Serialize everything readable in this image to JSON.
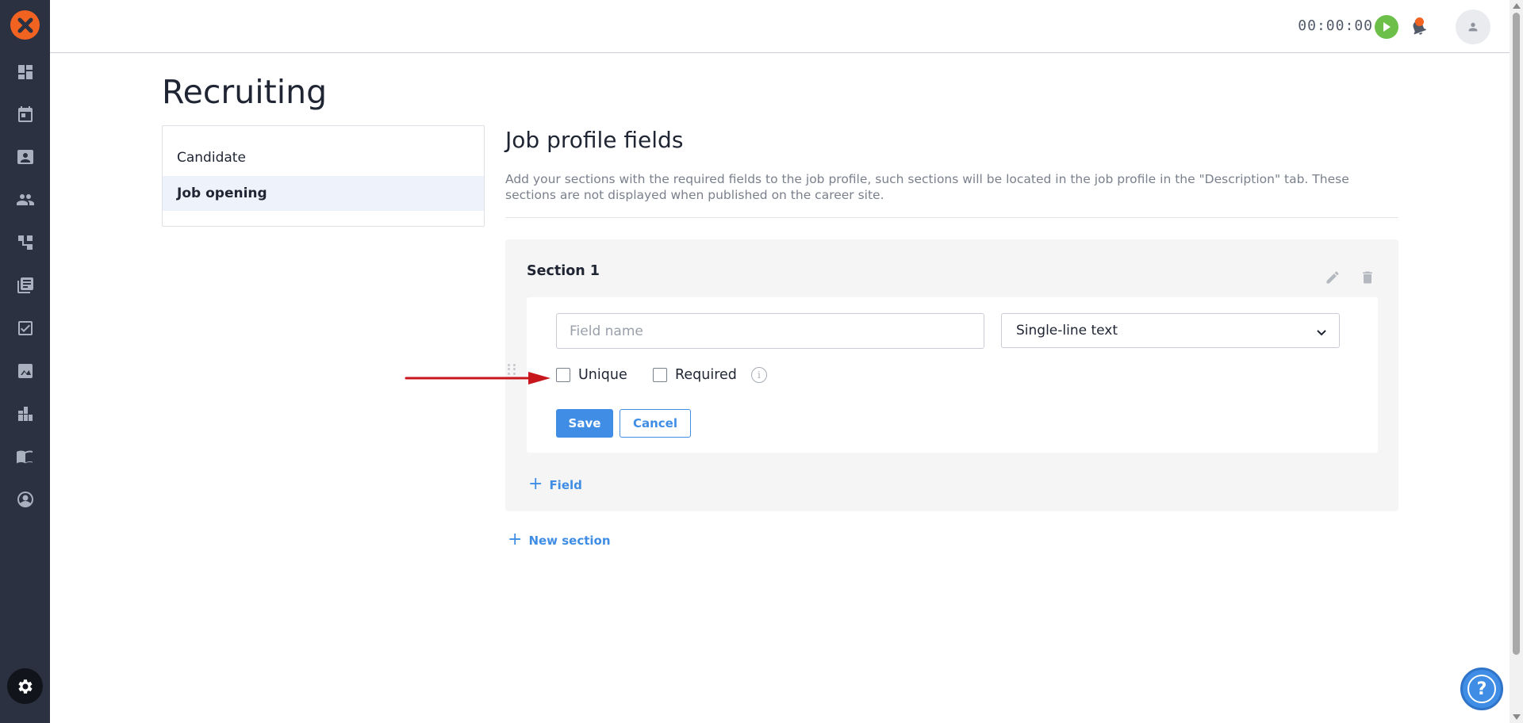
{
  "app": {
    "brand_color": "#f26322",
    "accent_color": "#3f8de4",
    "sidebar_icons": [
      "dashboard-icon",
      "calendar-icon",
      "contact-card-icon",
      "people-icon",
      "workflow-icon",
      "library-icon",
      "checkbox-icon",
      "chart-icon",
      "modules-icon",
      "book-icon",
      "user-circle-icon"
    ],
    "settings_icon": "gear-icon"
  },
  "topbar": {
    "timer": "00:00:00",
    "play_icon": "play-icon",
    "notifications_icon": "bell-icon",
    "avatar_icon": "user-icon"
  },
  "page": {
    "title": "Recruiting"
  },
  "settings_menu": {
    "items": [
      {
        "label": "Candidate",
        "active": false
      },
      {
        "label": "Job opening",
        "active": true
      }
    ]
  },
  "main": {
    "heading": "Job profile fields",
    "description": "Add your sections with the required fields to the job profile, such sections will be located in the job profile in the \"Description\" tab. These sections are not displayed when published on the career site.",
    "section": {
      "title": "Section 1",
      "edit_icon": "pencil-icon",
      "delete_icon": "trash-icon",
      "field": {
        "name_value": "",
        "name_placeholder": "Field name",
        "type_selected": "Single-line text",
        "unique_label": "Unique",
        "unique_checked": false,
        "required_label": "Required",
        "required_checked": false,
        "info_icon": "info-icon",
        "save_label": "Save",
        "cancel_label": "Cancel"
      },
      "add_field_label": "Field"
    },
    "new_section_label": "New section"
  },
  "annotation": {
    "arrow_color": "#c8161d"
  },
  "help": {
    "icon": "question-icon",
    "glyph": "?"
  }
}
